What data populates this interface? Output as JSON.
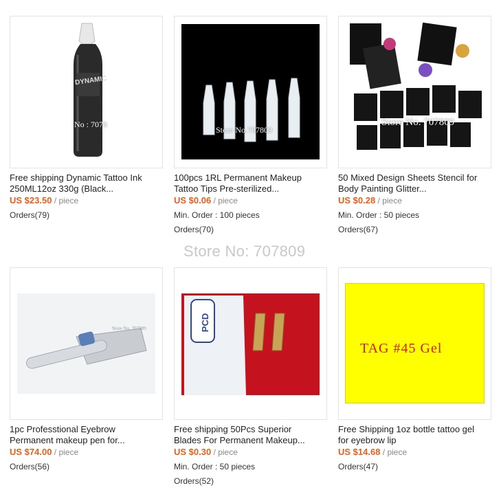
{
  "center_watermark": "Store No: 707809",
  "products": [
    {
      "title_line1": "Free shipping Dynamic Tattoo Ink",
      "title_line2": "250ML12oz 330g (Black...",
      "price": "US $23.50",
      "unit": "/ piece",
      "min_order": "",
      "orders": "Orders(79)",
      "watermark": "No : 7078",
      "image_label": "DYNAMIC"
    },
    {
      "title_line1": "100pcs 1RL Permanent Makeup",
      "title_line2": "Tattoo Tips Pre-sterilized...",
      "price": "US $0.06",
      "unit": "/ piece",
      "min_order": "Min. Order : 100 pieces",
      "orders": "Orders(70)",
      "watermark": "Store No.707809"
    },
    {
      "title_line1": "50 Mixed Design Sheets Stencil for",
      "title_line2": "Body Painting Glitter...",
      "price": "US $0.28",
      "unit": "/ piece",
      "min_order": "Min. Order : 50 pieces",
      "orders": "Orders(67)",
      "watermark": "Store No. 707809"
    },
    {
      "title_line1": "1pc Professtional Eyebrow",
      "title_line2": "Permanent makeup pen for...",
      "price": "US $74.00",
      "unit": "/ piece",
      "min_order": "",
      "orders": "Orders(56)",
      "watermark": "Store No. 707809"
    },
    {
      "title_line1": "Free shipping 50Pcs Superior",
      "title_line2": "Blades For Permanent Makeup...",
      "price": "US $0.30",
      "unit": "/ piece",
      "min_order": "Min. Order : 50 pieces",
      "orders": "Orders(52)",
      "watermark": "",
      "image_label": "PCD"
    },
    {
      "title_line1": "Free Shipping 1oz bottle tattoo gel",
      "title_line2": "for eyebrow lip",
      "price": "US $14.68",
      "unit": "/ piece",
      "min_order": "",
      "orders": "Orders(47)",
      "image_label": "TAG #45 Gel"
    }
  ],
  "colors": {
    "price": "#e4601c",
    "gel_bg": "#ffff00",
    "gel_text": "#d11d1d"
  }
}
